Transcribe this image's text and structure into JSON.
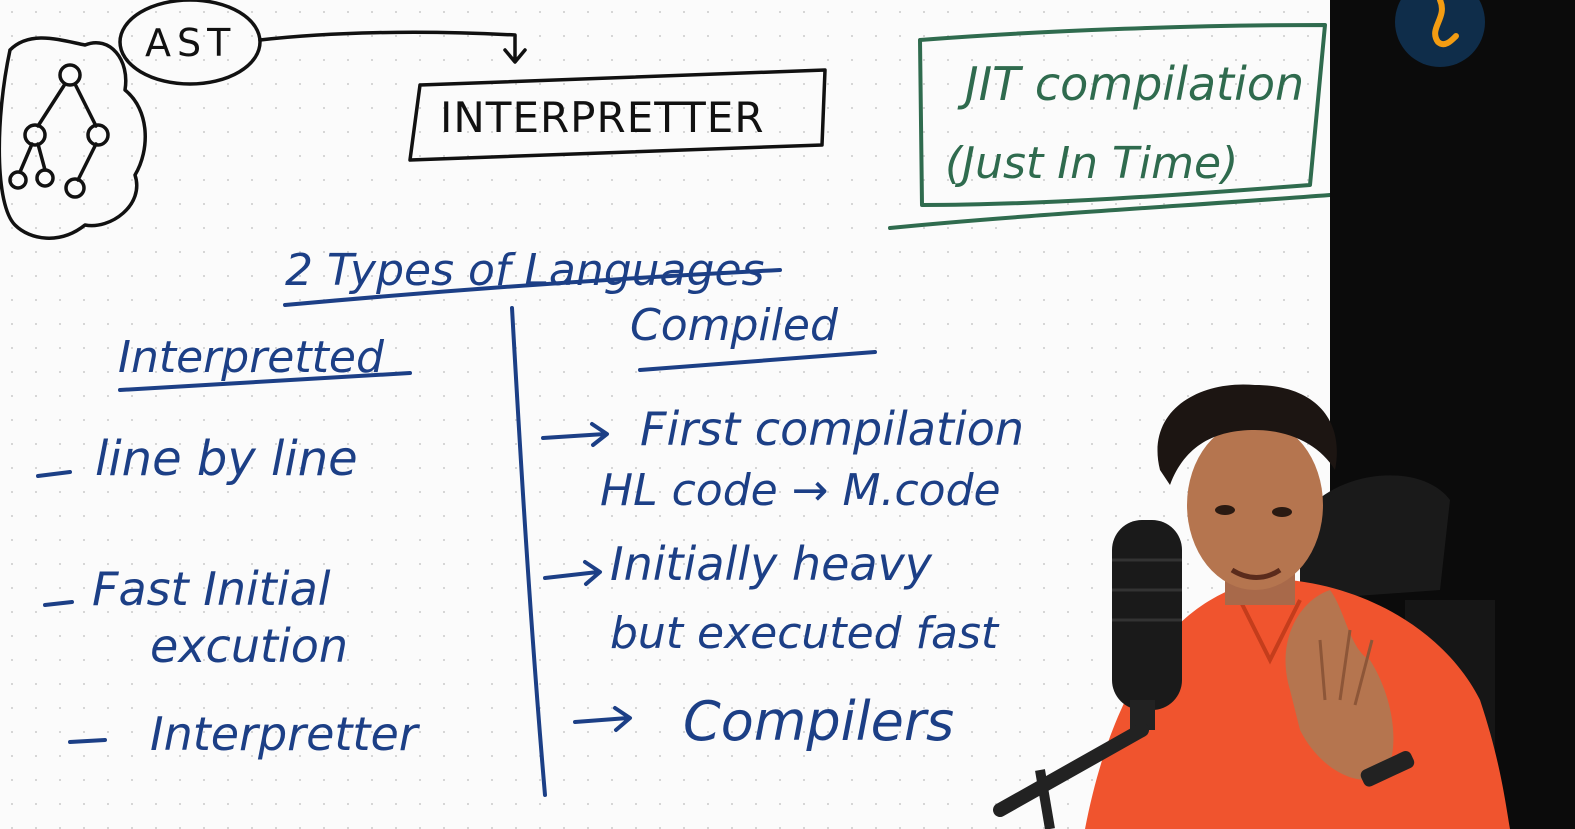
{
  "whiteboard": {
    "ast_label": "AST",
    "interpreter_box": "INTERPRETTER",
    "jit_title": "JIT compilation",
    "jit_subtitle": "(Just In Time)",
    "heading": "2 Types of Languages",
    "left_column": {
      "header": "Interpretted",
      "items": [
        "line by line",
        "Fast Initial",
        "excution",
        "Interpretter"
      ]
    },
    "right_column": {
      "header": "Compiled",
      "items": [
        "First compilation",
        "HL code → M.code",
        "Initially heavy",
        "but executed fast",
        "Compilers"
      ]
    }
  },
  "colors": {
    "board": "#fbfbfb",
    "blue_ink": "#1c3f86",
    "green_ink": "#2f6b4e",
    "presenter_shirt": "#f0542e",
    "logo_bg": "#0f2d4a",
    "logo_accent": "#f39c12"
  },
  "overlay": {
    "channel_logo_icon": "channel-logo-icon",
    "presenter": "presenter-with-microphone"
  }
}
